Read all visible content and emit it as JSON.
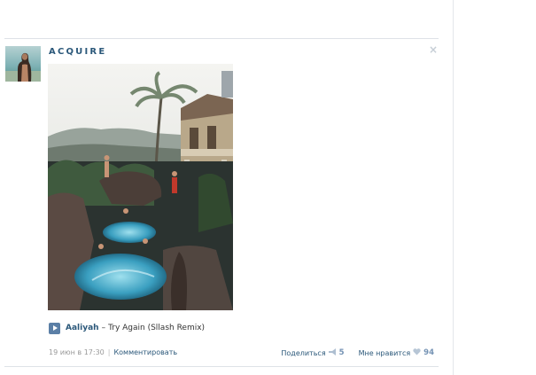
{
  "post": {
    "author": "ACQUIRE",
    "close_label": "×",
    "audio": {
      "artist": "Aaliyah",
      "separator": "–",
      "title": "Try Again (Sllash Remix)"
    },
    "date": "19 июн в 17:30",
    "comment_label": "Комментировать",
    "share_label": "Поделиться",
    "share_count": "5",
    "like_label": "Мне нравится",
    "like_count": "94"
  },
  "colors": {
    "link": "#2b587a",
    "meta": "#999999",
    "play_button": "#5b7fa6"
  }
}
